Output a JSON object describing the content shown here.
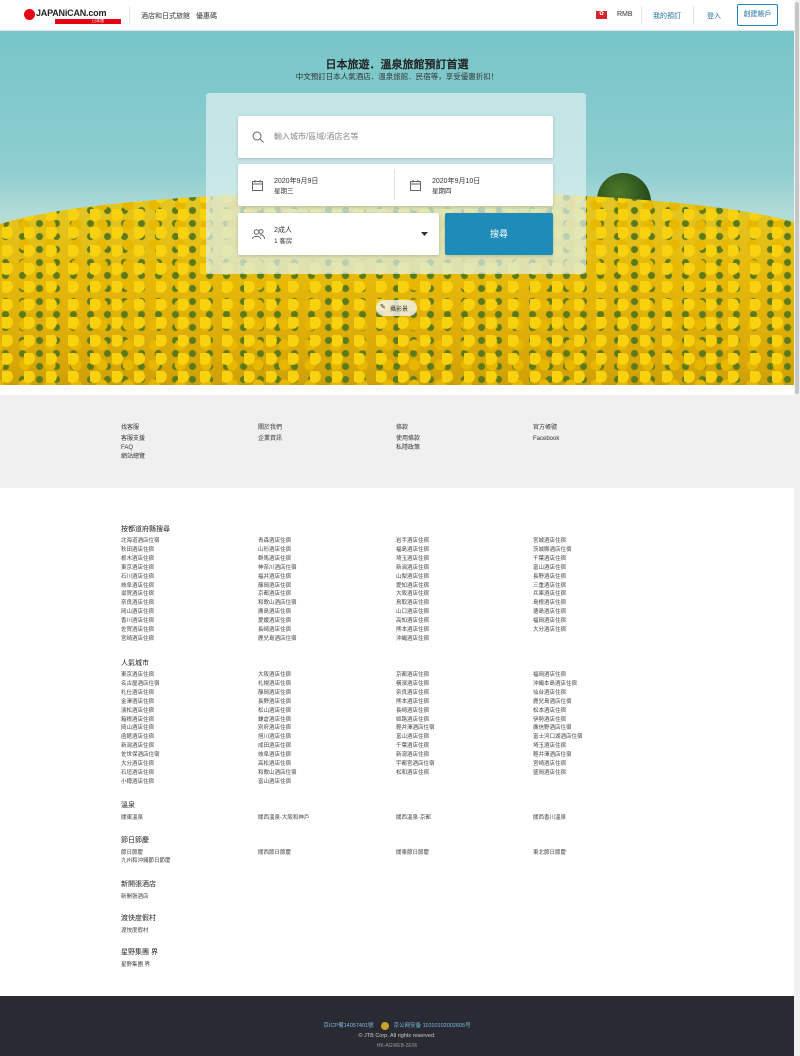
{
  "header": {
    "logo_text": "JAPANiCAN.com",
    "logo_sub": "日本旅遊專家",
    "nav": [
      "酒店和日式旅館",
      "優惠碼"
    ],
    "currency": "RMB",
    "my_booking": "我的預訂",
    "login": "登入",
    "signup": "創建帳戶"
  },
  "hero": {
    "title": "日本旅遊．溫泉旅館預訂首選",
    "subtitle": "中文預訂日本人氣酒店．溫泉旅館．民宿等，享受優惠折扣！",
    "search_placeholder": "輸入城市/區域/酒店名等",
    "checkin_date": "2020年9月9日",
    "checkin_day": "星期三",
    "checkout_date": "2020年9月10日",
    "checkout_day": "星期四",
    "guests_adults": "2成人",
    "guests_rooms": "1 客房",
    "search_button": "搜尋",
    "photo_credit": "攝影景"
  },
  "footer_links": [
    {
      "head": "找客服",
      "items": [
        "客服支援",
        "FAQ",
        "網站總覽"
      ]
    },
    {
      "head": "關於我們",
      "items": [
        "企業資訊"
      ]
    },
    {
      "head": "條款",
      "items": [
        "使用條款",
        "私隱政策"
      ]
    },
    {
      "head": "官方帳號",
      "items": [
        "Facebook"
      ]
    }
  ],
  "directory": {
    "prefectures": {
      "title": "按都道府縣搜尋",
      "cols": [
        [
          "北海道酒店住宿",
          "秋田酒店住宿",
          "栃木酒店住宿",
          "東京酒店住宿",
          "石川酒店住宿",
          "岐阜酒店住宿",
          "滋賀酒店住宿",
          "奈良酒店住宿",
          "岡山酒店住宿",
          "香川酒店住宿",
          "佐賀酒店住宿",
          "宮崎酒店住宿"
        ],
        [
          "青森酒店住宿",
          "山形酒店住宿",
          "群馬酒店住宿",
          "神奈川酒店住宿",
          "福井酒店住宿",
          "靜岡酒店住宿",
          "京都酒店住宿",
          "和歌山酒店住宿",
          "廣島酒店住宿",
          "愛媛酒店住宿",
          "長崎酒店住宿",
          "鹿兒島酒店住宿"
        ],
        [
          "岩手酒店住宿",
          "福島酒店住宿",
          "埼玉酒店住宿",
          "新潟酒店住宿",
          "山梨酒店住宿",
          "愛知酒店住宿",
          "大阪酒店住宿",
          "鳥取酒店住宿",
          "山口酒店住宿",
          "高知酒店住宿",
          "熊本酒店住宿",
          "沖繩酒店住宿"
        ],
        [
          "宮城酒店住宿",
          "茨城縣酒店住宿",
          "千葉酒店住宿",
          "富山酒店住宿",
          "長野酒店住宿",
          "三重酒店住宿",
          "兵庫酒店住宿",
          "島根酒店住宿",
          "德島酒店住宿",
          "福岡酒店住宿",
          "大分酒店住宿"
        ]
      ]
    },
    "cities": {
      "title": "人氣城市",
      "cols": [
        [
          "東京酒店住宿",
          "名古屋酒店住宿",
          "札仕酒店住宿",
          "金澤酒店住宿",
          "濱松酒店住宿",
          "箱根酒店住宿",
          "岡山酒店住宿",
          "函館酒店住宿",
          "新潟酒店住宿",
          "佐世保酒店住宿",
          "大分酒店住宿",
          "石垣酒店住宿",
          "小樽酒店住宿"
        ],
        [
          "大阪酒店住宿",
          "札幌酒店住宿",
          "靜岡酒店住宿",
          "長野酒店住宿",
          "松山酒店住宿",
          "鎌倉酒店住宿",
          "別府酒店住宿",
          "旭川酒店住宿",
          "成田酒店住宿",
          "岐阜酒店住宿",
          "高松酒店住宿",
          "和歌山酒店住宿",
          "富山酒店住宿"
        ],
        [
          "京都酒店住宿",
          "橫濱酒店住宿",
          "奈良酒店住宿",
          "熊本酒店住宿",
          "長崎酒店住宿",
          "姬路酒店住宿",
          "輕井澤酒店住宿",
          "富山酒店住宿",
          "千葉酒店住宿",
          "新瀉酒店住宿",
          "宇都宮酒店住宿",
          "松和酒店住宿"
        ],
        [
          "福岡酒店住宿",
          "沖繩本島酒店住宿",
          "仙台酒店住宿",
          "鹿兒島酒店住宿",
          "松本酒店住宿",
          "伊勢酒店住宿",
          "廣信野酒店住宿",
          "富士河口湖酒店住宿",
          "埼玉酒店住宿",
          "輕井澤酒店住宿",
          "宮崎酒店住宿",
          "盛岡酒店住宿"
        ]
      ]
    },
    "onsen": {
      "title": "溫泉",
      "items": [
        "關東溫泉",
        "關西溫泉-大阪和神戶",
        "關西溫泉-京都",
        "關西香川溫泉"
      ]
    },
    "festivals": {
      "title": "節日節慶",
      "cols": [
        [
          "節日節慶",
          "九州和沖繩節日節慶"
        ],
        [
          "關西節日節慶"
        ],
        [
          "關東節日節慶"
        ],
        [
          "東北節日節慶"
        ]
      ]
    },
    "new_hotels": {
      "title": "新開張酒店",
      "item": "新開張酒店"
    },
    "resort": {
      "title": "渡快度假村",
      "item": "渡快度假村"
    },
    "hoshino": {
      "title": "星野集團 界",
      "item": "星野集團 界"
    }
  },
  "bottom": {
    "icp": "京ICP備14057401號",
    "police": "京公网安备 11010102002605号",
    "copyright": "© JTB Corp. All rights reserved.",
    "code": "HK-AGWEB-2E06"
  }
}
